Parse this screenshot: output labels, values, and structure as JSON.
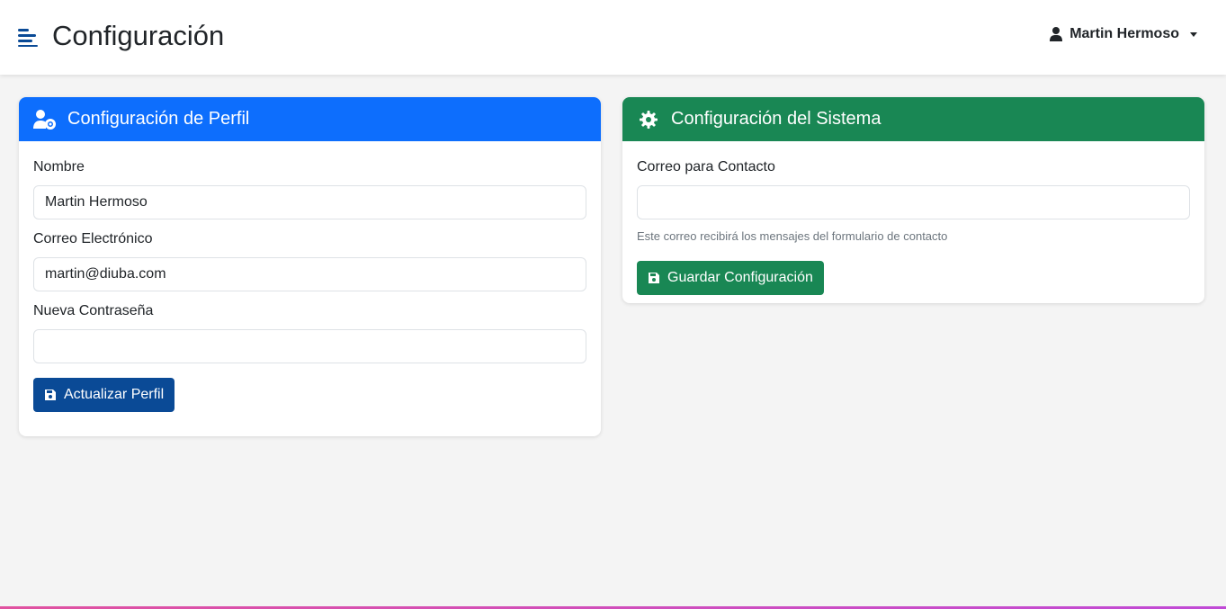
{
  "header": {
    "title": "Configuración",
    "user_name": "Martin Hermoso",
    "menu_icon": "menu-icon"
  },
  "profile_card": {
    "title": "Configuración de Perfil",
    "icon": "user-gear-icon",
    "fields": {
      "name_label": "Nombre",
      "name_value": "Martin Hermoso",
      "email_label": "Correo Electrónico",
      "email_value": "martin@diuba.com",
      "password_label": "Nueva Contraseña",
      "password_value": ""
    },
    "submit_label": "Actualizar Perfil"
  },
  "system_card": {
    "title": "Configuración del Sistema",
    "icon": "gear-icon",
    "contact_label": "Correo para Contacto",
    "contact_value": "",
    "contact_help": "Este correo recibirá los mensajes del formulario de contacto",
    "submit_label": "Guardar Configuración"
  },
  "colors": {
    "primary": "#0d6efd",
    "primary_button": "#0a4a96",
    "success": "#198754",
    "background": "#f4f4f4"
  }
}
